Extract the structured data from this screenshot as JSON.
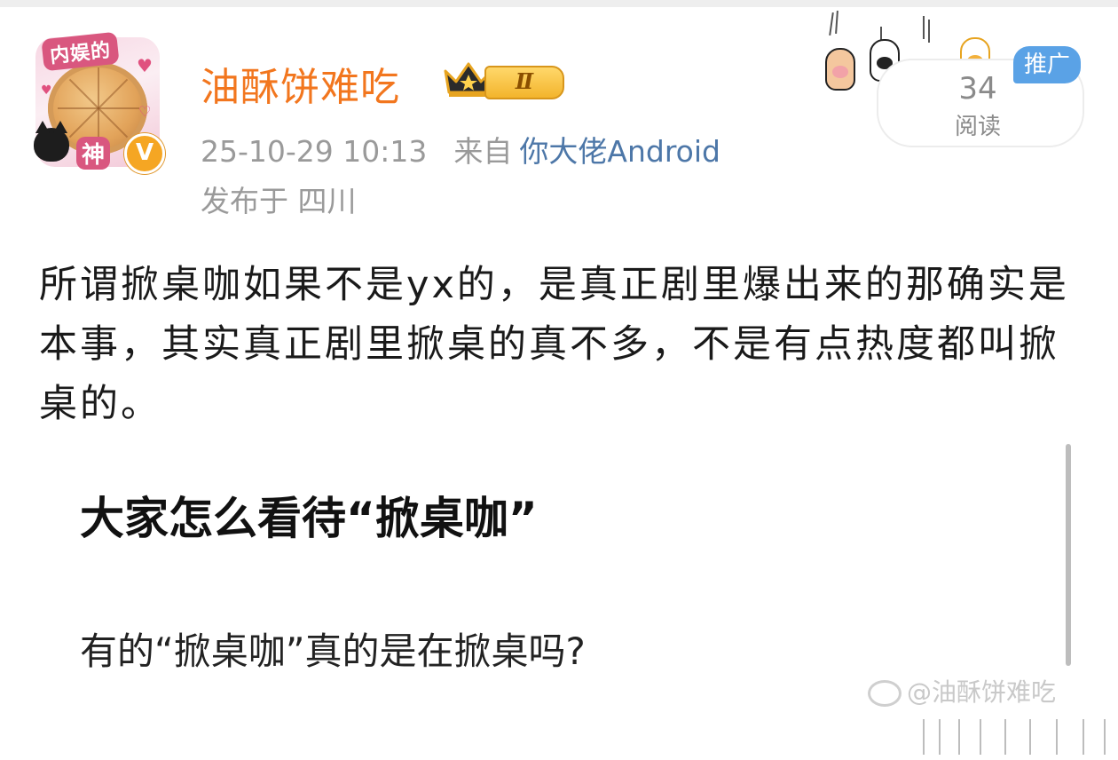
{
  "author": {
    "name": "油酥饼难吃",
    "level_badge": "Ⅱ",
    "verified_mark": "V",
    "avatar_text_top": "内娱的",
    "avatar_text_bottom": "神"
  },
  "meta": {
    "timestamp": "25-10-29 10:13",
    "from_label": "来自",
    "source": "你大佬Android",
    "location": "发布于 四川"
  },
  "stats": {
    "reads_count": "34",
    "reads_label": "阅读",
    "promo_label": "推广"
  },
  "post": {
    "text": "所谓掀桌咖如果不是yx的，是真正剧里爆出来的那确实是本事，其实真正剧里掀桌的真不多，不是有点热度都叫掀桌的。"
  },
  "image_card": {
    "title": "大家怎么看待“掀桌咖”",
    "subtitle": "有的“掀桌咖”真的是在掀桌吗?",
    "watermark": "@油酥饼难吃"
  },
  "icons": {
    "crown": "crown-icon",
    "paws": "cat-paws-decoration",
    "watermark_logo": "weibo-logo-icon"
  },
  "colors": {
    "username": "#f2761e",
    "source_link": "#4d77a8",
    "promo_badge": "#5aa2e6",
    "meta_text": "#9a9a9a"
  }
}
